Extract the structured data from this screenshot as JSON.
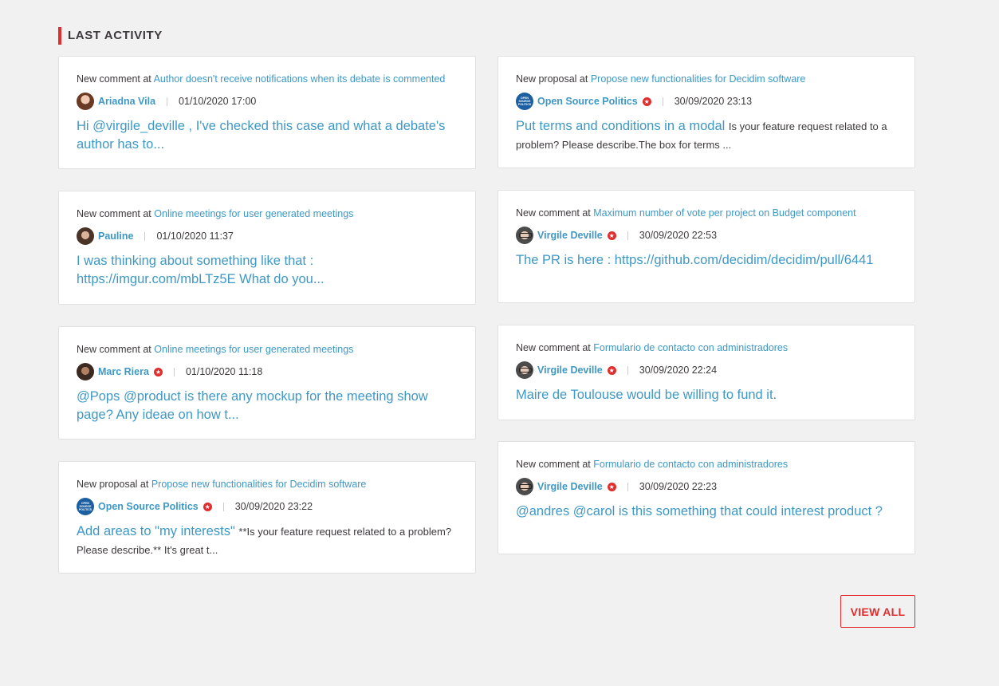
{
  "section_title": "LAST ACTIVITY",
  "view_all_label": "VIEW ALL",
  "cards": [
    {
      "type": "New comment at",
      "link": "Author doesn't receive notifications when its debate is commented",
      "author": "Ariadna Vila",
      "verified": false,
      "date": "01/10/2020 17:00",
      "title": "Hi @virgile_deville , I've checked this case and what a debate's author has to...",
      "excerpt": ""
    },
    {
      "type": "New comment at",
      "link": "Online meetings for user generated meetings",
      "author": "Pauline",
      "verified": false,
      "date": "01/10/2020 11:37",
      "title": "I was thinking about something like that : https://imgur.com/mbLTz5E What do you...",
      "excerpt": ""
    },
    {
      "type": "New comment at",
      "link": "Online meetings for user generated meetings",
      "author": "Marc Riera",
      "verified": true,
      "date": "01/10/2020 11:18",
      "title": "@Pops @product is there any mockup for the meeting show page? Any ideae on how t...",
      "excerpt": ""
    },
    {
      "type": "New proposal at",
      "link": "Propose new functionalities for Decidim software",
      "author": "Open Source Politics",
      "verified": true,
      "date": "30/09/2020 23:22",
      "title": "Add areas to \"my interests\"",
      "excerpt": "**Is your feature request related to a problem? Please describe.** It's great t..."
    },
    {
      "type": "New proposal at",
      "link": "Propose new functionalities for Decidim software",
      "author": "Open Source Politics",
      "verified": true,
      "date": "30/09/2020 23:13",
      "title": "Put terms and conditions in a modal",
      "excerpt": "Is your feature request related to a problem? Please describe.The box for terms ..."
    },
    {
      "type": "New comment at",
      "link": "Maximum number of vote per project on Budget component",
      "author": "Virgile Deville",
      "verified": true,
      "date": "30/09/2020 22:53",
      "title": "The PR is here : https://github.com/decidim/decidim/pull/6441",
      "excerpt": ""
    },
    {
      "type": "New comment at",
      "link": "Formulario de contacto con administradores",
      "author": "Virgile Deville",
      "verified": true,
      "date": "30/09/2020 22:24",
      "title": "Maire de Toulouse would be willing to fund it.",
      "excerpt": ""
    },
    {
      "type": "New comment at",
      "link": "Formulario de contacto con administradores",
      "author": "Virgile Deville",
      "verified": true,
      "date": "30/09/2020 22:23",
      "title": "@andres @carol is this something that could interest product ?",
      "excerpt": ""
    }
  ],
  "osp_logo_text": "OPEN SOURCE POLITICS",
  "colors": {
    "accent": "#e02d2d",
    "link": "#3e98c6",
    "text": "#3d393c",
    "background": "#f2f1f2"
  }
}
